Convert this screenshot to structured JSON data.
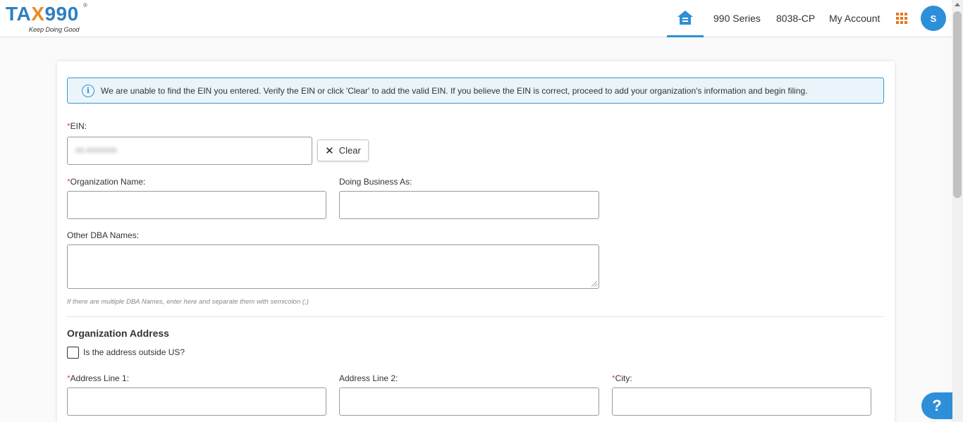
{
  "header": {
    "logo": {
      "text_left": "TA",
      "text_x": "X",
      "text_right": "990",
      "registered": "®",
      "tagline": "Keep Doing Good"
    },
    "nav": {
      "series": "990 Series",
      "cp": "8038-CP",
      "account": "My Account"
    },
    "avatar_initial": "S"
  },
  "alert": {
    "message": "We are unable to find the EIN you entered. Verify the EIN or click 'Clear' to add the valid EIN. If you believe the EIN is correct, proceed to add your organization's information and begin filing."
  },
  "form": {
    "required_mark": "*",
    "ein_label": "EIN:",
    "ein_value": "00-0000000",
    "clear_label": "Clear",
    "org_name_label": "Organization Name:",
    "dba_label": "Doing Business As:",
    "other_dba_label": "Other DBA Names:",
    "other_dba_hint": "If there are multiple DBA Names, enter here and separate them with semicolon (;)",
    "address_section_title": "Organization Address",
    "outside_us_label": "Is the address outside US?",
    "address1_label": "Address Line 1:",
    "address2_label": "Address Line 2:",
    "city_label": "City:"
  },
  "help_label": "?",
  "colors": {
    "brand_blue": "#2d8fd8",
    "brand_orange": "#e8761f",
    "required": "#d9534f"
  }
}
